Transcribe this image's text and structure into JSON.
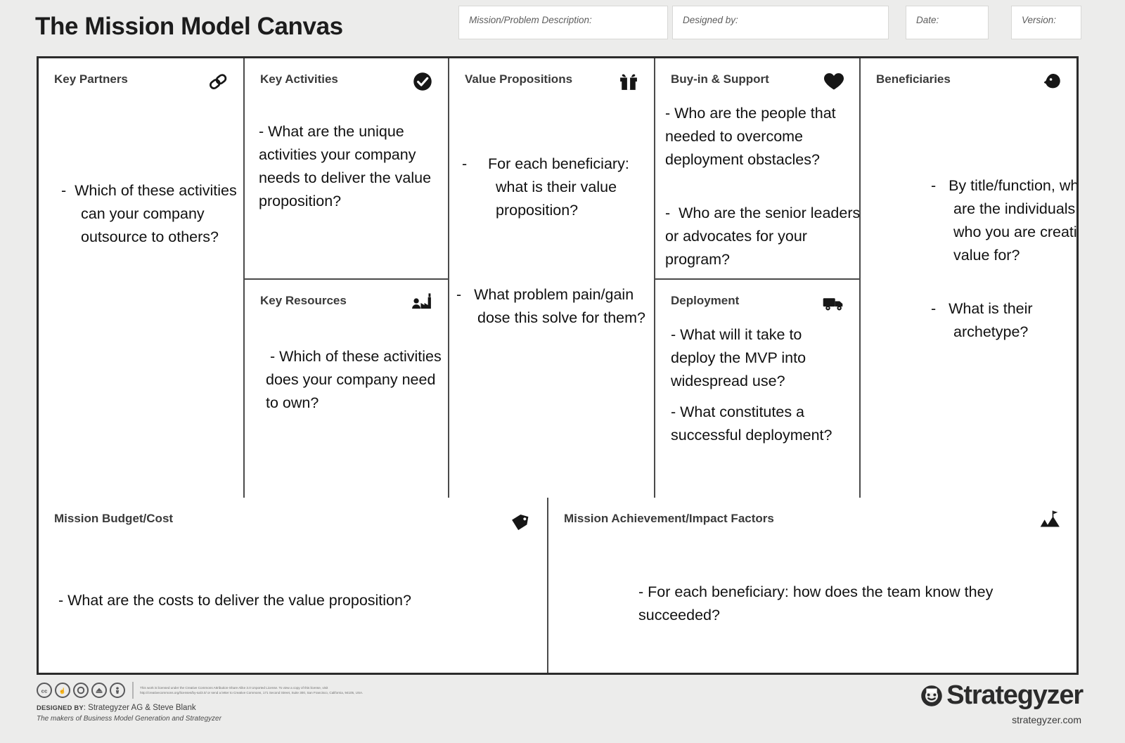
{
  "header": {
    "title": "The Mission Model Canvas",
    "fields": [
      {
        "label": "Mission/Problem Description:",
        "value": ""
      },
      {
        "label": "Designed by:",
        "value": ""
      },
      {
        "label": "Date:",
        "value": ""
      },
      {
        "label": "Version:",
        "value": ""
      }
    ]
  },
  "blocks": {
    "key_partners": {
      "title": "Key Partners",
      "icon": "chain-link-icon",
      "text": "-  Which of these activities can your company outsource to others?"
    },
    "key_activities": {
      "title": "Key Activities",
      "icon": "check-circle-icon",
      "text": "- What are the unique activities your company needs to deliver the value proposition?"
    },
    "key_resources": {
      "title": "Key Resources",
      "icon": "factory-worker-icon",
      "text": " - Which of these activities does your company need to own?"
    },
    "value_propositions": {
      "title": "Value Propositions",
      "icon": "gift-icon",
      "text_1": "-     For each beneficiary: what is their value proposition?",
      "text_2": "-   What problem pain/gain dose this solve for them?"
    },
    "buy_in_support": {
      "title": "Buy-in & Support",
      "icon": "heart-icon",
      "text_1": "- Who are the people that needed to overcome deployment obstacles?",
      "text_2": "-  Who are the senior leaders or advocates for your program?"
    },
    "deployment": {
      "title": "Deployment",
      "icon": "delivery-truck-icon",
      "text_1": "- What will it take to deploy the MVP into widespread use?",
      "text_2": "- What constitutes a successful deployment?"
    },
    "beneficiaries": {
      "title": "Beneficiaries",
      "icon": "person-head-icon",
      "text_1": "-   By title/function, who are the individuals who you are creating value for?",
      "text_2": "-   What is their archetype?"
    },
    "mission_budget": {
      "title": "Mission Budget/Cost",
      "icon": "price-tag-icon",
      "text": "- What are the costs to deliver the value proposition?"
    },
    "mission_achievement": {
      "title": "Mission Achievement/Impact Factors",
      "icon": "mountain-flag-icon",
      "text": "- For each beneficiary: how does the team know they succeeded?"
    }
  },
  "footer": {
    "cc_icons": [
      "cc-icon",
      "cc-by-icon",
      "cc-nd-icon",
      "cc-sa-icon",
      "cc-attribution-icon"
    ],
    "license_line_1": "This work is licensed under the Creative Commons Attribution-Share Alike 3.0 Unported License. To view a copy of this license, visit",
    "license_line_2": "http://creativecommons.org/licenses/by-sa/3.0/ or send a letter to Creative Commons, 171 Second Street, Suite 300, San Francisco, California, 94105, USA.",
    "designed_by_label": "DESIGNED BY",
    "designed_by_value": ": Strategyzer AG & Steve Blank",
    "makers": "The makers of Business Model Generation and Strategyzer",
    "brand_name": "Strategyzer",
    "brand_url": "strategyzer.com"
  },
  "colors": {
    "page_bg": "#ececeb",
    "canvas_border": "#2b2b2b",
    "cell_border": "#4a4a4a",
    "title_color": "#1c1c1c",
    "heading_color": "#3a3a3a",
    "body_color": "#111111",
    "field_label": "#5d5d5d"
  }
}
